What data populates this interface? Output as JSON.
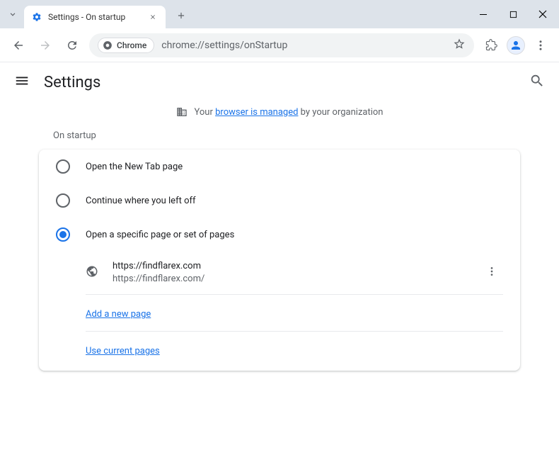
{
  "window": {
    "tab_title": "Settings - On startup"
  },
  "addressbar": {
    "chip_label": "Chrome",
    "url": "chrome://settings/onStartup"
  },
  "header": {
    "title": "Settings"
  },
  "managed": {
    "prefix": "Your ",
    "link": "browser is managed",
    "suffix": " by your organization"
  },
  "startup": {
    "section_label": "On startup",
    "options": [
      {
        "label": "Open the New Tab page",
        "selected": false
      },
      {
        "label": "Continue where you left off",
        "selected": false
      },
      {
        "label": "Open a specific page or set of pages",
        "selected": true
      }
    ],
    "pages": [
      {
        "title": "https://findflarex.com",
        "url": "https://findflarex.com/"
      }
    ],
    "add_page_label": "Add a new page",
    "use_current_label": "Use current pages"
  }
}
